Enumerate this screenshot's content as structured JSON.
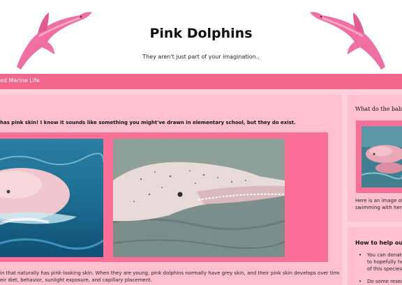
{
  "header": {
    "title": "Pink Dolphins",
    "subtitle": "They aren't just part of your imagination.."
  },
  "nav": {
    "link_label": "ed Marine Life"
  },
  "main": {
    "intro": "has pink skin! I know it sounds like something you might've drawn in elementary school, but they do exist.",
    "desc_line1": "in that naturally has pink-looking skin. When they are young, pink dolphins normally have grey skin, and their pink skin develops over time. Their",
    "desc_line2": "eir diet, behavior, sunlight exposure, and capillary placement."
  },
  "sidebar": {
    "babies_heading": "What do the babies",
    "babies_text_line1": "Here is an image of a",
    "babies_text_line2": "swimming with her m",
    "help_heading": "How to help out",
    "help_items": [
      [
        "You can donate",
        "to hopefully he",
        "of this species"
      ],
      [
        "Do some resea"
      ]
    ]
  },
  "colors": {
    "accent": "#f3678d",
    "card": "#ffc1d0",
    "page": "#ffd1dc",
    "dolphin": "#ee6fa0"
  }
}
